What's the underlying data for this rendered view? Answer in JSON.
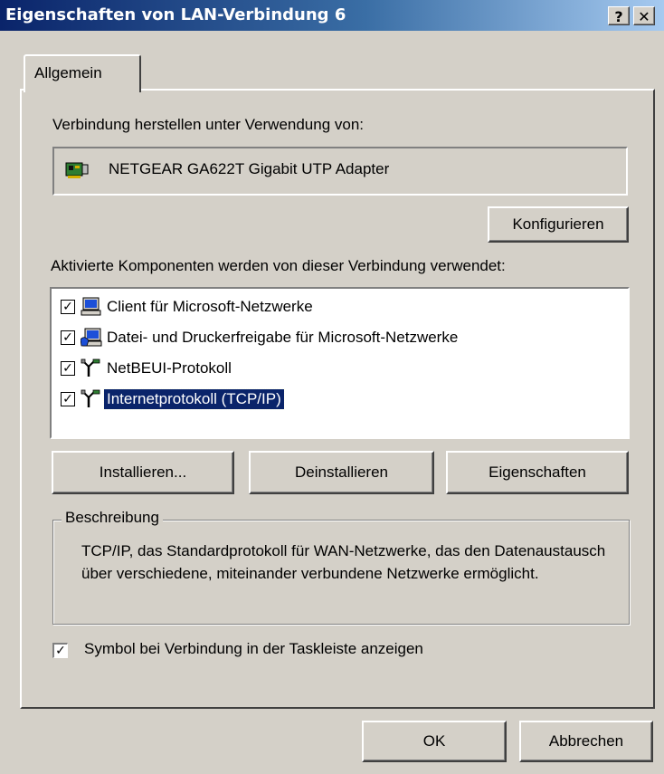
{
  "window": {
    "title": "Eigenschaften von LAN-Verbindung 6",
    "help_glyph": "?",
    "close_glyph": "✕"
  },
  "tabs": [
    {
      "label": "Allgemein",
      "active": true
    }
  ],
  "connection": {
    "label": "Verbindung herstellen unter Verwendung von:",
    "adapter_name": "NETGEAR GA622T Gigabit UTP Adapter",
    "adapter_icon": "network-card-icon",
    "configure_button": "Konfigurieren"
  },
  "components": {
    "label": "Aktivierte Komponenten werden von dieser Verbindung verwendet:",
    "items": [
      {
        "label": "Client für Microsoft-Netzwerke",
        "checked": true,
        "icon": "computer-icon",
        "selected": false
      },
      {
        "label": "Datei- und Druckerfreigabe für Microsoft-Netzwerke",
        "checked": true,
        "icon": "shared-computer-icon",
        "selected": false
      },
      {
        "label": "NetBEUI-Protokoll",
        "checked": true,
        "icon": "protocol-icon",
        "selected": false
      },
      {
        "label": "Internetprotokoll (TCP/IP)",
        "checked": true,
        "icon": "protocol-icon",
        "selected": true
      }
    ],
    "install_button": "Installieren...",
    "uninstall_button": "Deinstallieren",
    "properties_button": "Eigenschaften"
  },
  "description": {
    "legend": "Beschreibung",
    "text": "TCP/IP, das Standardprotokoll für WAN-Netzwerke, das den Datenaustausch über verschiedene, miteinander verbundene Netzwerke ermöglicht."
  },
  "taskbar_option": {
    "label": "Symbol bei Verbindung in der Taskleiste anzeigen",
    "checked": true
  },
  "footer": {
    "ok_button": "OK",
    "cancel_button": "Abbrechen"
  },
  "colors": {
    "titlebar_start": "#0a246a",
    "titlebar_end": "#a6caf0",
    "face": "#d4d0c8",
    "selection": "#0a246a"
  }
}
